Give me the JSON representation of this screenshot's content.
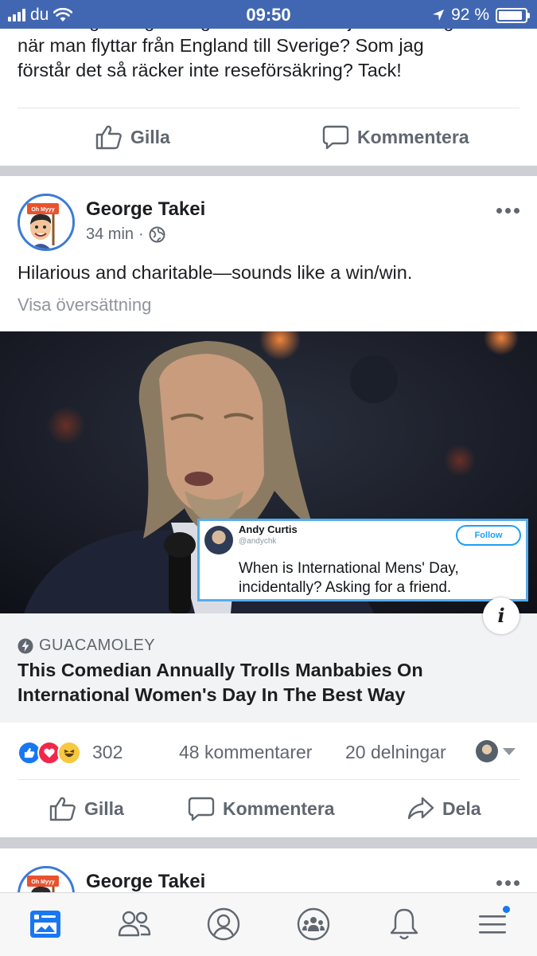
{
  "status_bar": {
    "carrier": "du",
    "time": "09:50",
    "battery": "92 %",
    "battery_level": 0.92
  },
  "previous_post": {
    "text_lines": [
      "försäkringsbolag som ger heltäckande sjukförsäkring",
      "när man flyttar från England till Sverige? Som jag",
      "förstår det så räcker inte reseförsäkring? Tack!"
    ],
    "like_label": "Gilla",
    "comment_label": "Kommentera"
  },
  "post": {
    "avatar_sign": "Oh Myyy",
    "author": "George Takei",
    "time_ago": "34 min",
    "separator": "·",
    "privacy_icon": "globe-icon",
    "text": "Hilarious and charitable—sounds like a win/win.",
    "translate_label": "Visa översättning",
    "embedded_tweet": {
      "name": "Andy Curtis",
      "handle": "@andychk",
      "follow_label": "Follow",
      "text": "When is International Mens' Day, incidentally? Asking for a friend."
    },
    "info_label": "i",
    "link": {
      "source": "GUACAMOLEY",
      "title": "This Comedian Annually Trolls Manbabies On International Women's Day In The Best Way"
    },
    "reactions": {
      "icons": [
        "like-reaction-icon",
        "love-reaction-icon",
        "haha-reaction-icon"
      ],
      "count": "302",
      "comments": "48 kommentarer",
      "shares": "20 delningar"
    },
    "actions": {
      "like": "Gilla",
      "comment": "Kommentera",
      "share": "Dela"
    }
  },
  "next_post": {
    "avatar_sign": "Oh Myyy",
    "author": "George Takei"
  },
  "tab_bar": {
    "items": [
      "news-feed-icon",
      "friends-icon",
      "profile-icon",
      "groups-icon",
      "notifications-icon",
      "menu-icon"
    ]
  },
  "colors": {
    "brand": "#4267b2",
    "text": "#1c1e21",
    "secondary": "#606770",
    "active_tab": "#1877f2",
    "divider_band": "#ccd0d5"
  }
}
